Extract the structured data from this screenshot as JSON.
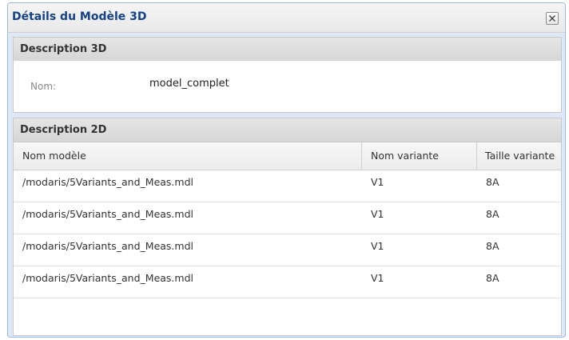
{
  "dialog": {
    "title": "Détails du Modèle 3D",
    "close_icon": "close-icon"
  },
  "panel3d": {
    "header": "Description 3D",
    "name_label": "Nom:",
    "name_value": "model_complet"
  },
  "panel2d": {
    "header": "Description 2D",
    "columns": [
      "Nom modèle",
      "Nom variante",
      "Taille variante"
    ],
    "rows": [
      [
        "/modaris/5Variants_and_Meas.mdl",
        "V1",
        "8A"
      ],
      [
        "/modaris/5Variants_and_Meas.mdl",
        "V1",
        "8A"
      ],
      [
        "/modaris/5Variants_and_Meas.mdl",
        "V1",
        "8A"
      ],
      [
        "/modaris/5Variants_and_Meas.mdl",
        "V1",
        "8A"
      ]
    ]
  }
}
